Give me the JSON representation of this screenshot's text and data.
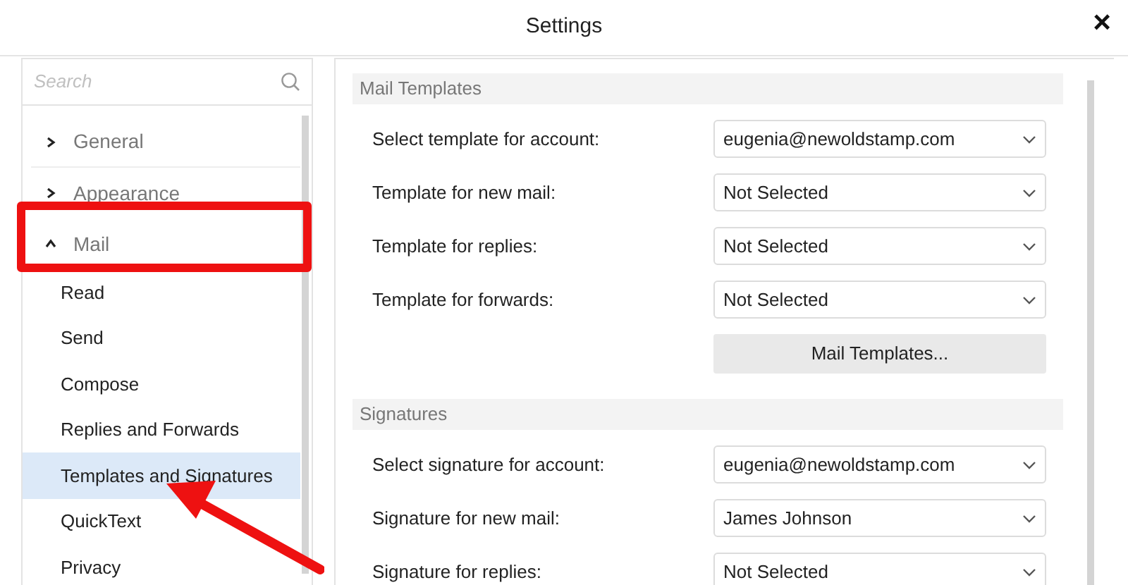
{
  "window": {
    "title": "Settings",
    "close": "×"
  },
  "sidebar": {
    "search": {
      "placeholder": "Search"
    },
    "items": [
      {
        "label": "General",
        "expanded": false,
        "selected": false
      },
      {
        "label": "Appearance",
        "expanded": false,
        "selected": false
      },
      {
        "label": "Mail",
        "expanded": true,
        "selected": false,
        "children": [
          {
            "label": "Read",
            "selected": false
          },
          {
            "label": "Send",
            "selected": false
          },
          {
            "label": "Compose",
            "selected": false
          },
          {
            "label": "Replies and Forwards",
            "selected": false
          },
          {
            "label": "Templates and Signatures",
            "selected": true
          },
          {
            "label": "QuickText",
            "selected": false
          },
          {
            "label": "Privacy",
            "selected": false
          }
        ]
      }
    ]
  },
  "sections": [
    {
      "title": "Mail Templates",
      "rows": [
        {
          "label": "Select template for account:",
          "value": "eugenia@newoldstamp.com"
        },
        {
          "label": "Template for new mail:",
          "value": "Not Selected"
        },
        {
          "label": "Template for replies:",
          "value": "Not Selected"
        },
        {
          "label": "Template for forwards:",
          "value": "Not Selected"
        }
      ],
      "button": "Mail Templates..."
    },
    {
      "title": "Signatures",
      "rows": [
        {
          "label": "Select signature for account:",
          "value": "eugenia@newoldstamp.com"
        },
        {
          "label": "Signature for new mail:",
          "value": "James Johnson"
        },
        {
          "label": "Signature for replies:",
          "value": "Not Selected"
        }
      ]
    }
  ]
}
